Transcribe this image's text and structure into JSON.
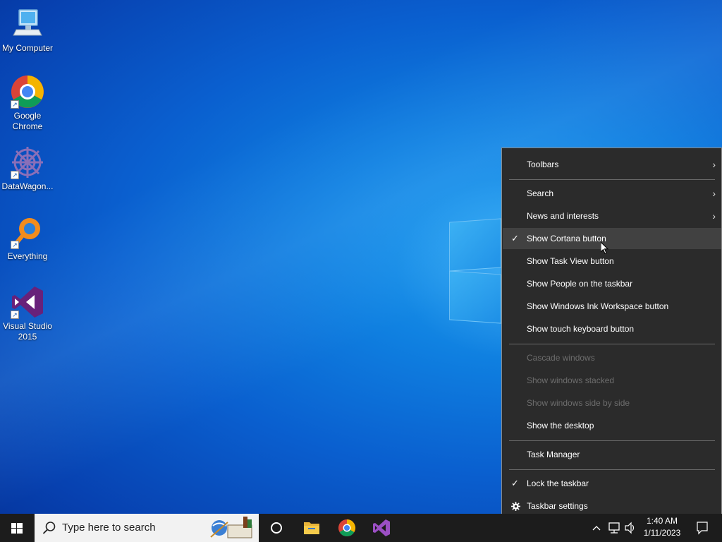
{
  "desktop": {
    "icons": [
      {
        "label": "My Computer",
        "icon": "computer-icon"
      },
      {
        "label": "Google Chrome",
        "icon": "chrome-icon"
      },
      {
        "label": "DataWagon...",
        "icon": "datawagon-icon"
      },
      {
        "label": "Everything",
        "icon": "everything-icon"
      },
      {
        "label": "Visual Studio 2015",
        "icon": "visual-studio-icon"
      }
    ]
  },
  "context_menu": {
    "items": [
      {
        "label": "Toolbars",
        "submenu": true
      },
      {
        "label": "Search",
        "submenu": true
      },
      {
        "label": "News and interests",
        "submenu": true
      },
      {
        "label": "Show Cortana button",
        "checked": true
      },
      {
        "label": "Show Task View button"
      },
      {
        "label": "Show People on the taskbar"
      },
      {
        "label": "Show Windows Ink Workspace button"
      },
      {
        "label": "Show touch keyboard button"
      },
      {
        "label": "Cascade windows",
        "disabled": true
      },
      {
        "label": "Show windows stacked",
        "disabled": true
      },
      {
        "label": "Show windows side by side",
        "disabled": true
      },
      {
        "label": "Show the desktop"
      },
      {
        "label": "Task Manager"
      },
      {
        "label": "Lock the taskbar",
        "checked": true
      },
      {
        "label": "Taskbar settings",
        "icon": "gear-icon"
      }
    ],
    "check_glyph": "✓",
    "arrow_glyph": "›"
  },
  "taskbar": {
    "search_placeholder": "Type here to search",
    "pinned": [
      "cortana-icon",
      "file-explorer-icon",
      "chrome-icon",
      "visual-studio-icon"
    ],
    "clock_time": "1:40 AM",
    "clock_date": "1/11/2023"
  },
  "colors": {
    "menu_bg": "#2b2b2b",
    "menu_hover": "#414141",
    "taskbar_bg": "#1c1c1c",
    "vs_purple": "#68217a"
  }
}
